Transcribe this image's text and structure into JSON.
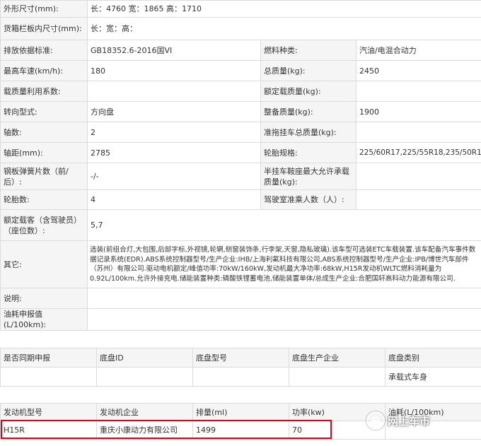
{
  "spec_table": {
    "rows": [
      {
        "label": "外形尺寸(mm):",
        "value": "长：4760 宽：1865 高：1710"
      },
      {
        "label": "货箱栏板内尺寸(mm):",
        "value": "长：宽：高："
      },
      {
        "label": "排放依据标准:",
        "value": "GB18352.6-2016国VI",
        "label2": "燃料种类:",
        "value2": "汽油/电混合动力"
      },
      {
        "label": "最高车速(km/h):",
        "value": "180",
        "label2": "总质量(kg):",
        "value2": "2450"
      },
      {
        "label": "载质量利用系数:",
        "value": "",
        "label2": "额定载质量(kg):",
        "value2": ""
      },
      {
        "label": "转向型式:",
        "value": "方向盘",
        "label2": "整备质量(kg):",
        "value2": "1900"
      },
      {
        "label": "轴数:",
        "value": "2",
        "label2": "准拖挂车总质量(kg):",
        "value2": ""
      },
      {
        "label": "轴距(mm):",
        "value": "2785",
        "label2": "轮胎规格:",
        "value2": "225/60R17,225/55R18,235/50R19"
      },
      {
        "label": "钢板弹簧片数（前/后）:",
        "value": "-/-",
        "label2": "半挂车鞍座最大允许承载质量(kg):",
        "value2": ""
      },
      {
        "label": "轮胎数:",
        "value": "4",
        "label2": "驾驶室准乘人数（人）:",
        "value2": ""
      },
      {
        "label": "额定载客（含驾驶员）（座位数）:",
        "value": "5,7"
      },
      {
        "label": "其它:",
        "value": "选装(前组合灯,大包围,后部字标,外视镜,轮辋,侧窗装饰条,行李架,天窗,隐私玻璃).该车型可选装ETC车载装置.该车配备汽车事件数据记录系统(EDR).ABS系统控制器型号/生产企业:IHB/上海利氟科技有限公司,ABS系统控制器型号/生产企业:IPB/博世汽车部件（苏州）有限公司.驱动电机额定/峰值功率:70kW/160kW,发动机最大净功率:68kW,H15R发动机WLTC燃料消耗量为0.92L/100km.允许外接充电.储能装置种类:磷酸铁锂蓄电池,储能装置单体/总成生产企业:合肥国轩高科动力能源有限公司."
      },
      {
        "label": "说明:",
        "value": ""
      },
      {
        "label": "油耗申报值(L/100km):",
        "value": ""
      }
    ]
  },
  "chassis_table": {
    "headers": [
      "是否同期申报",
      "底盘ID",
      "底盘型号",
      "底盘生产企业",
      "底盘类别"
    ],
    "row": [
      "",
      "",
      "",
      "",
      "承载式车身"
    ]
  },
  "engine_table": {
    "headers": [
      "发动机型号",
      "发动机企业",
      "排量(ml)",
      "功率(kw)",
      "油耗(L/100km)"
    ],
    "row": [
      "H15R",
      "重庆小康动力有限公司",
      "1499",
      "70",
      ""
    ]
  },
  "watermark": {
    "text": "网上车市",
    "logo_icon": "steering-wheel-icon"
  },
  "colors": {
    "highlight": "#e60012",
    "label_bg": "#f5f5f5",
    "border": "#dcdcdc"
  }
}
